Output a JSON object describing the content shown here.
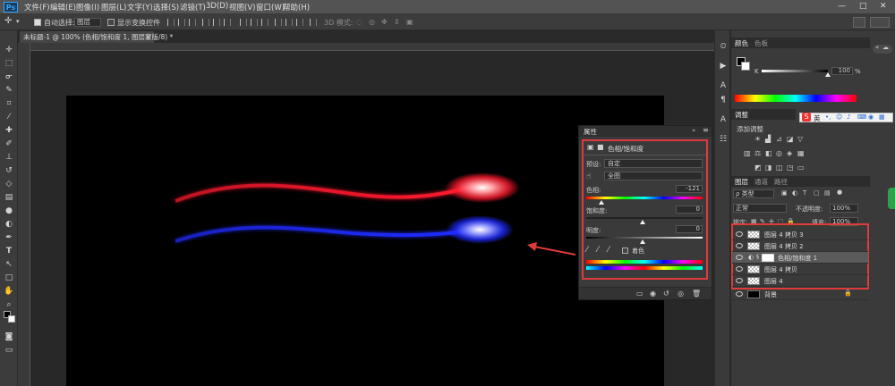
{
  "app": {
    "logo": "Ps"
  },
  "menu": [
    "文件(F)",
    "编辑(E)",
    "图像(I)",
    "图层(L)",
    "文字(Y)",
    "选择(S)",
    "滤镜(T)",
    "3D(D)",
    "视图(V)",
    "窗口(W)",
    "帮助(H)"
  ],
  "window_controls": {
    "minimize": "—",
    "maximize": "□",
    "close": "✕"
  },
  "options": {
    "auto_select_label": "自动选择:",
    "auto_select_value": "图层",
    "show_transform_label": "显示变换控件",
    "mode3d_label": "3D 模式:"
  },
  "document": {
    "tab_title": "未标题-1 @ 100% (色相/饱和度 1, 图层蒙版/8) *",
    "close": "✕"
  },
  "properties": {
    "title": "属性",
    "adjustment_name": "色相/饱和度",
    "preset_label": "预设:",
    "preset_value": "自定",
    "range_value": "全图",
    "hue_label": "色相:",
    "hue_value": "-121",
    "saturation_label": "饱和度:",
    "saturation_value": "0",
    "lightness_label": "明度:",
    "lightness_value": "0",
    "colorize_label": "着色"
  },
  "color_panel": {
    "tabs": [
      "颜色",
      "色板"
    ],
    "k_label": "K",
    "k_value": "100",
    "k_unit": "%"
  },
  "adjustments_panel": {
    "title": "调整",
    "subtitle": "添加调整"
  },
  "ime_bar": {
    "lang": "英"
  },
  "layers_panel": {
    "tabs": [
      "图层",
      "通道",
      "路径"
    ],
    "filter_label": "ρ 类型",
    "blend_mode": "正常",
    "opacity_label": "不透明度:",
    "opacity_value": "100%",
    "lock_label": "锁定:",
    "fill_label": "填充:",
    "fill_value": "100%",
    "layers": [
      {
        "name": "图层 4 拷贝 3",
        "selected": false
      },
      {
        "name": "图层 4 拷贝 2",
        "selected": false
      },
      {
        "name": "色相/饱和度 1",
        "selected": true
      },
      {
        "name": "图层 4 拷贝",
        "selected": false
      },
      {
        "name": "图层 4",
        "selected": false
      },
      {
        "name": "背景",
        "selected": false
      }
    ]
  },
  "colors": {
    "accent_red": "#e03b3b",
    "stroke_red": "#ff1a2e",
    "stroke_blue": "#1f2bff"
  },
  "icons": {
    "toolbar": [
      "move-icon",
      "marquee-icon",
      "lasso-icon",
      "quick-select-icon",
      "crop-icon",
      "eyedropper-icon",
      "healing-icon",
      "brush-icon",
      "stamp-icon",
      "history-brush-icon",
      "eraser-icon",
      "gradient-icon",
      "blur-icon",
      "dodge-icon",
      "pen-icon",
      "type-icon",
      "path-select-icon",
      "rectangle-icon",
      "hand-icon",
      "zoom-icon"
    ]
  }
}
